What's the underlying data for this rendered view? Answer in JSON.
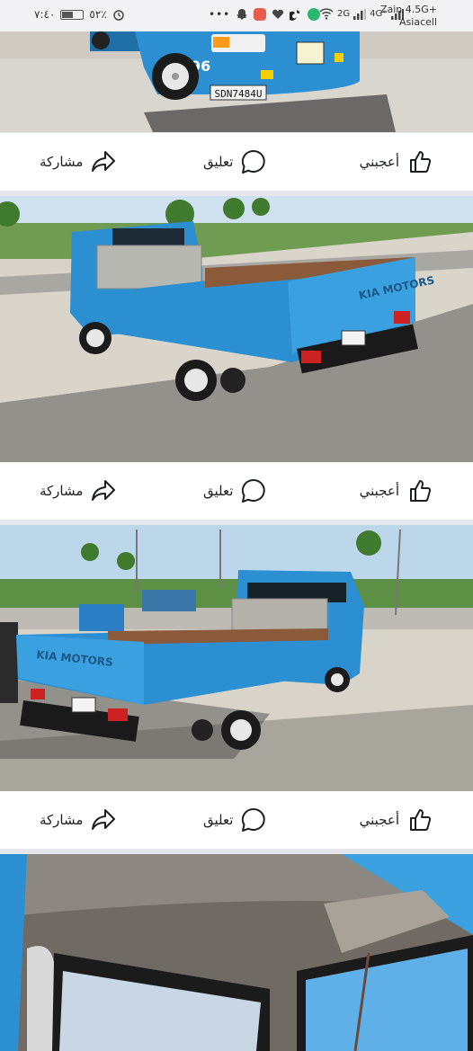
{
  "status_bar": {
    "time": "٧:٤٠",
    "battery_label": "٥٢٪",
    "battery_level": 0.52,
    "network_2g": "2G",
    "network_4g": "4G⁺",
    "carrier_line1": "Zain 4.5G+",
    "carrier_line2": "Asiacell",
    "icons": [
      "alarm-icon",
      "snapchat-icon",
      "app-icon",
      "heart-icon",
      "tiktok-icon",
      "app-icon",
      "wifi-icon",
      "signal-icon",
      "signal-icon"
    ]
  },
  "posts": [
    {
      "truck_plate": "SDN7484U",
      "cab_number": "96",
      "actions": {
        "like": "أعجبني",
        "comment": "تعليق",
        "share": "مشاركة"
      }
    },
    {
      "truck_brand_text": "KIA MOTORS",
      "actions": {
        "like": "أعجبني",
        "comment": "تعليق",
        "share": "مشاركة"
      }
    },
    {
      "truck_brand_text": "KIA MOTORS",
      "actions": {
        "like": "أعجبني",
        "comment": "تعليق",
        "share": "مشاركة"
      }
    },
    {
      "description": "truck cab interior photo"
    }
  ],
  "colors": {
    "truck_blue": "#2b8fd1",
    "background": "#e4e6eb",
    "action_text": "#1c1e21"
  }
}
